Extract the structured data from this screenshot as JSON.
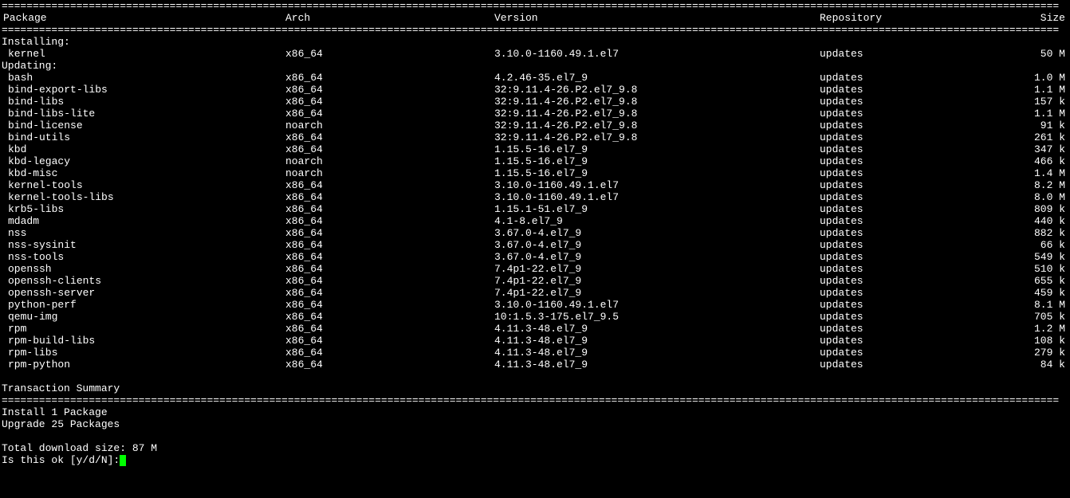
{
  "rule": "==========================================================================================================================================================================",
  "headers": {
    "package": "Package",
    "arch": "Arch",
    "version": "Version",
    "repository": "Repository",
    "size": "Size"
  },
  "sections": {
    "installing": "Installing:",
    "updating": "Updating:",
    "txn_summary": "Transaction Summary"
  },
  "installing": [
    {
      "pkg": "kernel",
      "arch": "x86_64",
      "ver": "3.10.0-1160.49.1.el7",
      "repo": "updates",
      "size": "50 M"
    }
  ],
  "updating": [
    {
      "pkg": "bash",
      "arch": "x86_64",
      "ver": "4.2.46-35.el7_9",
      "repo": "updates",
      "size": "1.0 M"
    },
    {
      "pkg": "bind-export-libs",
      "arch": "x86_64",
      "ver": "32:9.11.4-26.P2.el7_9.8",
      "repo": "updates",
      "size": "1.1 M"
    },
    {
      "pkg": "bind-libs",
      "arch": "x86_64",
      "ver": "32:9.11.4-26.P2.el7_9.8",
      "repo": "updates",
      "size": "157 k"
    },
    {
      "pkg": "bind-libs-lite",
      "arch": "x86_64",
      "ver": "32:9.11.4-26.P2.el7_9.8",
      "repo": "updates",
      "size": "1.1 M"
    },
    {
      "pkg": "bind-license",
      "arch": "noarch",
      "ver": "32:9.11.4-26.P2.el7_9.8",
      "repo": "updates",
      "size": "91 k"
    },
    {
      "pkg": "bind-utils",
      "arch": "x86_64",
      "ver": "32:9.11.4-26.P2.el7_9.8",
      "repo": "updates",
      "size": "261 k"
    },
    {
      "pkg": "kbd",
      "arch": "x86_64",
      "ver": "1.15.5-16.el7_9",
      "repo": "updates",
      "size": "347 k"
    },
    {
      "pkg": "kbd-legacy",
      "arch": "noarch",
      "ver": "1.15.5-16.el7_9",
      "repo": "updates",
      "size": "466 k"
    },
    {
      "pkg": "kbd-misc",
      "arch": "noarch",
      "ver": "1.15.5-16.el7_9",
      "repo": "updates",
      "size": "1.4 M"
    },
    {
      "pkg": "kernel-tools",
      "arch": "x86_64",
      "ver": "3.10.0-1160.49.1.el7",
      "repo": "updates",
      "size": "8.2 M"
    },
    {
      "pkg": "kernel-tools-libs",
      "arch": "x86_64",
      "ver": "3.10.0-1160.49.1.el7",
      "repo": "updates",
      "size": "8.0 M"
    },
    {
      "pkg": "krb5-libs",
      "arch": "x86_64",
      "ver": "1.15.1-51.el7_9",
      "repo": "updates",
      "size": "809 k"
    },
    {
      "pkg": "mdadm",
      "arch": "x86_64",
      "ver": "4.1-8.el7_9",
      "repo": "updates",
      "size": "440 k"
    },
    {
      "pkg": "nss",
      "arch": "x86_64",
      "ver": "3.67.0-4.el7_9",
      "repo": "updates",
      "size": "882 k"
    },
    {
      "pkg": "nss-sysinit",
      "arch": "x86_64",
      "ver": "3.67.0-4.el7_9",
      "repo": "updates",
      "size": "66 k"
    },
    {
      "pkg": "nss-tools",
      "arch": "x86_64",
      "ver": "3.67.0-4.el7_9",
      "repo": "updates",
      "size": "549 k"
    },
    {
      "pkg": "openssh",
      "arch": "x86_64",
      "ver": "7.4p1-22.el7_9",
      "repo": "updates",
      "size": "510 k"
    },
    {
      "pkg": "openssh-clients",
      "arch": "x86_64",
      "ver": "7.4p1-22.el7_9",
      "repo": "updates",
      "size": "655 k"
    },
    {
      "pkg": "openssh-server",
      "arch": "x86_64",
      "ver": "7.4p1-22.el7_9",
      "repo": "updates",
      "size": "459 k"
    },
    {
      "pkg": "python-perf",
      "arch": "x86_64",
      "ver": "3.10.0-1160.49.1.el7",
      "repo": "updates",
      "size": "8.1 M"
    },
    {
      "pkg": "qemu-img",
      "arch": "x86_64",
      "ver": "10:1.5.3-175.el7_9.5",
      "repo": "updates",
      "size": "705 k"
    },
    {
      "pkg": "rpm",
      "arch": "x86_64",
      "ver": "4.11.3-48.el7_9",
      "repo": "updates",
      "size": "1.2 M"
    },
    {
      "pkg": "rpm-build-libs",
      "arch": "x86_64",
      "ver": "4.11.3-48.el7_9",
      "repo": "updates",
      "size": "108 k"
    },
    {
      "pkg": "rpm-libs",
      "arch": "x86_64",
      "ver": "4.11.3-48.el7_9",
      "repo": "updates",
      "size": "279 k"
    },
    {
      "pkg": "rpm-python",
      "arch": "x86_64",
      "ver": "4.11.3-48.el7_9",
      "repo": "updates",
      "size": "84 k"
    }
  ],
  "summary": {
    "install": "Install   1 Package",
    "upgrade": "Upgrade  25 Packages",
    "download": "Total download size: 87 M",
    "prompt": "Is this ok [y/d/N]: "
  }
}
